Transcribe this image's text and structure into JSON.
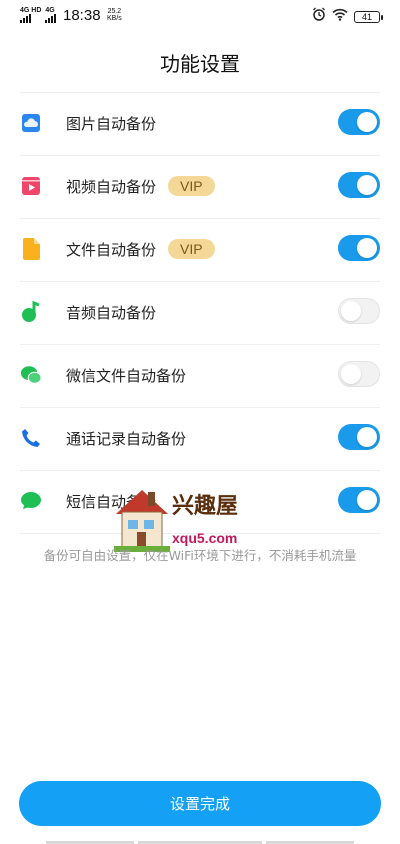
{
  "status_bar": {
    "net1": "4G HD",
    "net2": "4G",
    "time": "18:38",
    "speed_value": "25.2",
    "speed_unit": "KB/s",
    "battery": "41",
    "icons": [
      "alarm-icon",
      "wifi-icon",
      "battery-icon"
    ]
  },
  "page": {
    "title": "功能设置"
  },
  "settings": [
    {
      "label": "图片自动备份",
      "icon": "cloud-photo-icon",
      "icon_color": "#2b86f0",
      "vip": false,
      "enabled": true
    },
    {
      "label": "视频自动备份",
      "icon": "video-icon",
      "icon_color": "#f0466a",
      "vip": true,
      "enabled": true
    },
    {
      "label": "文件自动备份",
      "icon": "file-icon",
      "icon_color": "#f9b21d",
      "vip": true,
      "enabled": true
    },
    {
      "label": "音频自动备份",
      "icon": "music-note-icon",
      "icon_color": "#1fbf55",
      "vip": false,
      "enabled": false
    },
    {
      "label": "微信文件自动备份",
      "icon": "wechat-icon",
      "icon_color": "#1fbf55",
      "vip": false,
      "enabled": false
    },
    {
      "label": "通话记录自动备份",
      "icon": "phone-icon",
      "icon_color": "#1a6fe0",
      "vip": false,
      "enabled": true
    },
    {
      "label": "短信自动备份",
      "icon": "sms-icon",
      "icon_color": "#1fbf55",
      "vip": false,
      "enabled": true
    }
  ],
  "vip_label": "VIP",
  "note": "备份可自由设置，仅在WiFi环境下进行，不消耗手机流量",
  "watermark": {
    "text": "兴趣屋",
    "url": "xqu5.com"
  },
  "done_button": "设置完成",
  "colors": {
    "accent": "#14a1f5",
    "vip_bg": "#f4d898"
  }
}
